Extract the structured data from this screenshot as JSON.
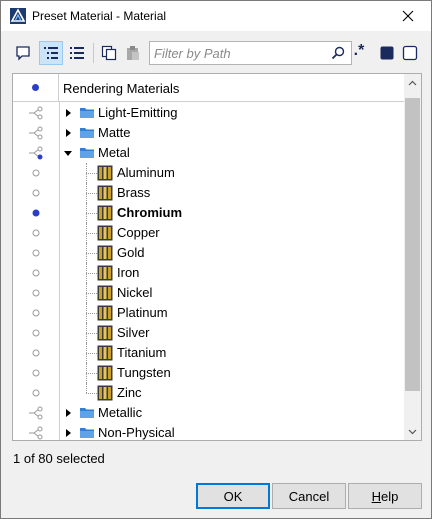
{
  "window": {
    "title": "Preset Material - Material"
  },
  "toolbar": {
    "filter_placeholder": "Filter by Path",
    "regex_label": ".*"
  },
  "tree": {
    "header_label": "Rendering Materials",
    "rows": [
      {
        "label": "Light-Emitting",
        "type": "folder",
        "expanded": false,
        "level": 0,
        "state": "link"
      },
      {
        "label": "Matte",
        "type": "folder",
        "expanded": false,
        "level": 0,
        "state": "link"
      },
      {
        "label": "Metal",
        "type": "folder",
        "expanded": true,
        "level": 0,
        "state": "link-partial"
      },
      {
        "label": "Aluminum",
        "type": "material",
        "level": 1,
        "state": "empty"
      },
      {
        "label": "Brass",
        "type": "material",
        "level": 1,
        "state": "empty"
      },
      {
        "label": "Chromium",
        "type": "material",
        "level": 1,
        "state": "selected",
        "bold": true
      },
      {
        "label": "Copper",
        "type": "material",
        "level": 1,
        "state": "empty"
      },
      {
        "label": "Gold",
        "type": "material",
        "level": 1,
        "state": "empty"
      },
      {
        "label": "Iron",
        "type": "material",
        "level": 1,
        "state": "empty"
      },
      {
        "label": "Nickel",
        "type": "material",
        "level": 1,
        "state": "empty"
      },
      {
        "label": "Platinum",
        "type": "material",
        "level": 1,
        "state": "empty"
      },
      {
        "label": "Silver",
        "type": "material",
        "level": 1,
        "state": "empty"
      },
      {
        "label": "Titanium",
        "type": "material",
        "level": 1,
        "state": "empty"
      },
      {
        "label": "Tungsten",
        "type": "material",
        "level": 1,
        "state": "empty"
      },
      {
        "label": "Zinc",
        "type": "material",
        "level": 1,
        "state": "empty"
      },
      {
        "label": "Metallic",
        "type": "folder",
        "expanded": false,
        "level": 0,
        "state": "link"
      },
      {
        "label": "Non-Physical",
        "type": "folder",
        "expanded": false,
        "level": 0,
        "state": "link"
      }
    ]
  },
  "status": {
    "text": "1 of 80 selected"
  },
  "buttons": {
    "ok": "OK",
    "cancel": "Cancel",
    "help_h": "H",
    "help_rest": "elp"
  },
  "colors": {
    "accent": "#0078d7",
    "selection_dot": "#2b3ec7",
    "folder": "#2f7fd4",
    "material_gold": "#c9a227"
  }
}
